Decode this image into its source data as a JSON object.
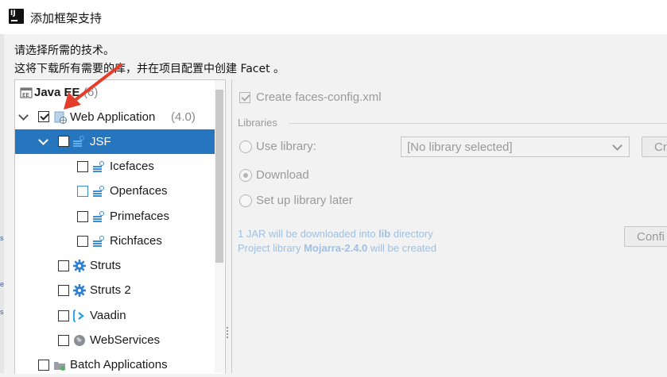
{
  "window": {
    "title": "添加框架支持"
  },
  "description": {
    "line1": "请选择所需的技术。",
    "line2": "这将下载所有需要的库，并在项目配置中创建 Facet 。"
  },
  "tree": {
    "group_label": "Java EE",
    "group_count": "(6)",
    "items": {
      "web_application": {
        "label": "Web Application",
        "version": "(4.0)",
        "checked": true
      },
      "jsf": {
        "label": "JSF",
        "checked": false
      },
      "icefaces": {
        "label": "Icefaces",
        "checked": false
      },
      "openfaces": {
        "label": "Openfaces",
        "checked": false
      },
      "primefaces": {
        "label": "Primefaces",
        "checked": false
      },
      "richfaces": {
        "label": "Richfaces",
        "checked": false
      },
      "struts": {
        "label": "Struts",
        "checked": false
      },
      "struts2": {
        "label": "Struts 2",
        "checked": false
      },
      "vaadin": {
        "label": "Vaadin",
        "checked": false
      },
      "webservices": {
        "label": "WebServices",
        "checked": false
      },
      "batch_applications": {
        "label": "Batch Applications",
        "checked": false
      }
    }
  },
  "settings": {
    "create_faces_config": "Create faces-config.xml",
    "libraries_label": "Libraries",
    "use_library": "Use library:",
    "library_select_value": "[No library selected]",
    "create_button": "Cr",
    "download": "Download",
    "setup_later": "Set up library later",
    "info_prefix": "1 JAR will be downloaded into ",
    "info_dir": "lib",
    "info_suffix": " directory",
    "project_prefix": "Project library ",
    "project_lib": "Mojarra-2.4.0",
    "project_suffix": " will be created",
    "configure_button": "Confi"
  },
  "colors": {
    "selection": "#2675bf",
    "annotation_arrow": "#e53c2b",
    "info_text": "#9fc0e0"
  }
}
